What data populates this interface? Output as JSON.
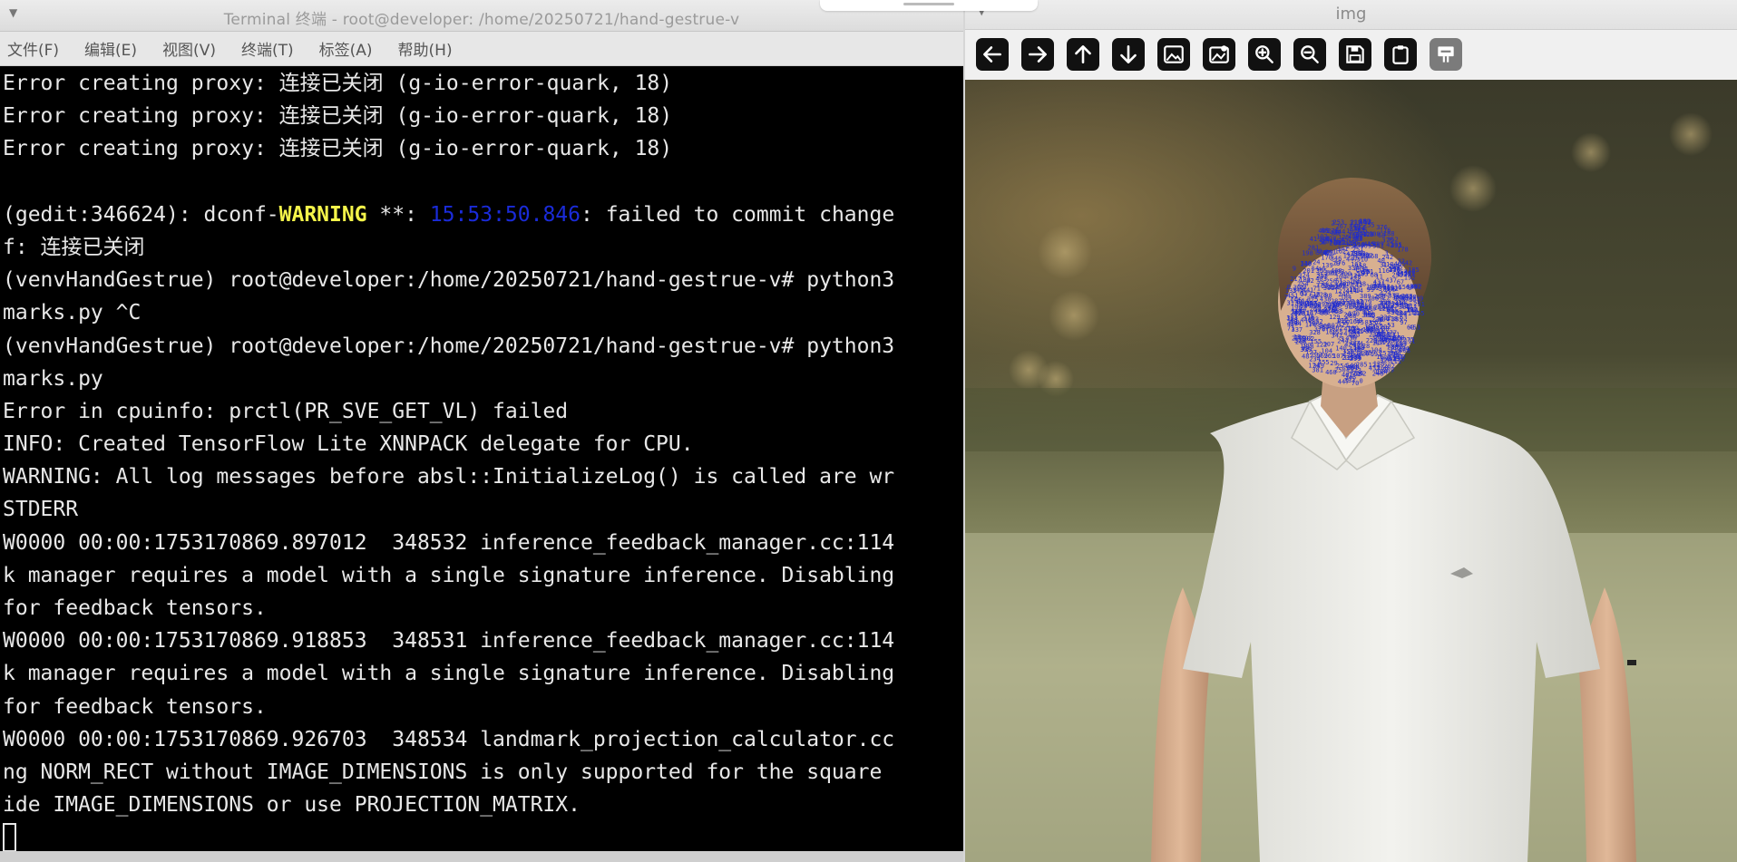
{
  "terminal": {
    "title": "Terminal 终端 - root@developer: /home/20250721/hand-gestrue-v",
    "menu": [
      "文件(F)",
      "编辑(E)",
      "视图(V)",
      "终端(T)",
      "标签(A)",
      "帮助(H)"
    ],
    "lines": [
      "Error creating proxy: 连接已关闭 (g-io-error-quark, 18)",
      "Error creating proxy: 连接已关闭 (g-io-error-quark, 18)",
      "Error creating proxy: 连接已关闭 (g-io-error-quark, 18)",
      "",
      {
        "parts": [
          {
            "t": "(gedit:346624): dconf-",
            "c": ""
          },
          {
            "t": "WARNING",
            "c": "warn"
          },
          {
            "t": " **: ",
            "c": ""
          },
          {
            "t": "15:53:50.846",
            "c": "ts"
          },
          {
            "t": ": failed to commit change",
            "c": ""
          }
        ]
      },
      "f: 连接已关闭",
      "(venvHandGestrue) root@developer:/home/20250721/hand-gestrue-v# python3",
      "marks.py ^C",
      "(venvHandGestrue) root@developer:/home/20250721/hand-gestrue-v# python3",
      "marks.py",
      "Error in cpuinfo: prctl(PR_SVE_GET_VL) failed",
      "INFO: Created TensorFlow Lite XNNPACK delegate for CPU.",
      "WARNING: All log messages before absl::InitializeLog() is called are wr",
      "STDERR",
      "W0000 00:00:1753170869.897012  348532 inference_feedback_manager.cc:114",
      "k manager requires a model with a single signature inference. Disabling",
      "for feedback tensors.",
      "W0000 00:00:1753170869.918853  348531 inference_feedback_manager.cc:114",
      "k manager requires a model with a single signature inference. Disabling",
      "for feedback tensors.",
      "W0000 00:00:1753170869.926703  348534 landmark_projection_calculator.cc",
      "ng NORM_RECT without IMAGE_DIMENSIONS is only supported for the square",
      "ide IMAGE_DIMENSIONS or use PROJECTION_MATRIX."
    ],
    "colors": {
      "background": "#000000",
      "text": "#e8e8e8",
      "warning": "#f4f44a",
      "timestamp": "#1a2bd9"
    }
  },
  "viewer": {
    "title": "img",
    "toolbar": [
      {
        "name": "back-arrow-icon"
      },
      {
        "name": "forward-arrow-icon"
      },
      {
        "name": "up-arrow-icon"
      },
      {
        "name": "down-arrow-icon"
      },
      {
        "name": "image-icon"
      },
      {
        "name": "image-settings-icon"
      },
      {
        "name": "zoom-in-icon"
      },
      {
        "name": "zoom-out-icon"
      },
      {
        "name": "save-icon"
      },
      {
        "name": "clipboard-icon"
      },
      {
        "name": "properties-icon"
      }
    ],
    "image": {
      "landmark_color": "#1e2bd0"
    }
  }
}
